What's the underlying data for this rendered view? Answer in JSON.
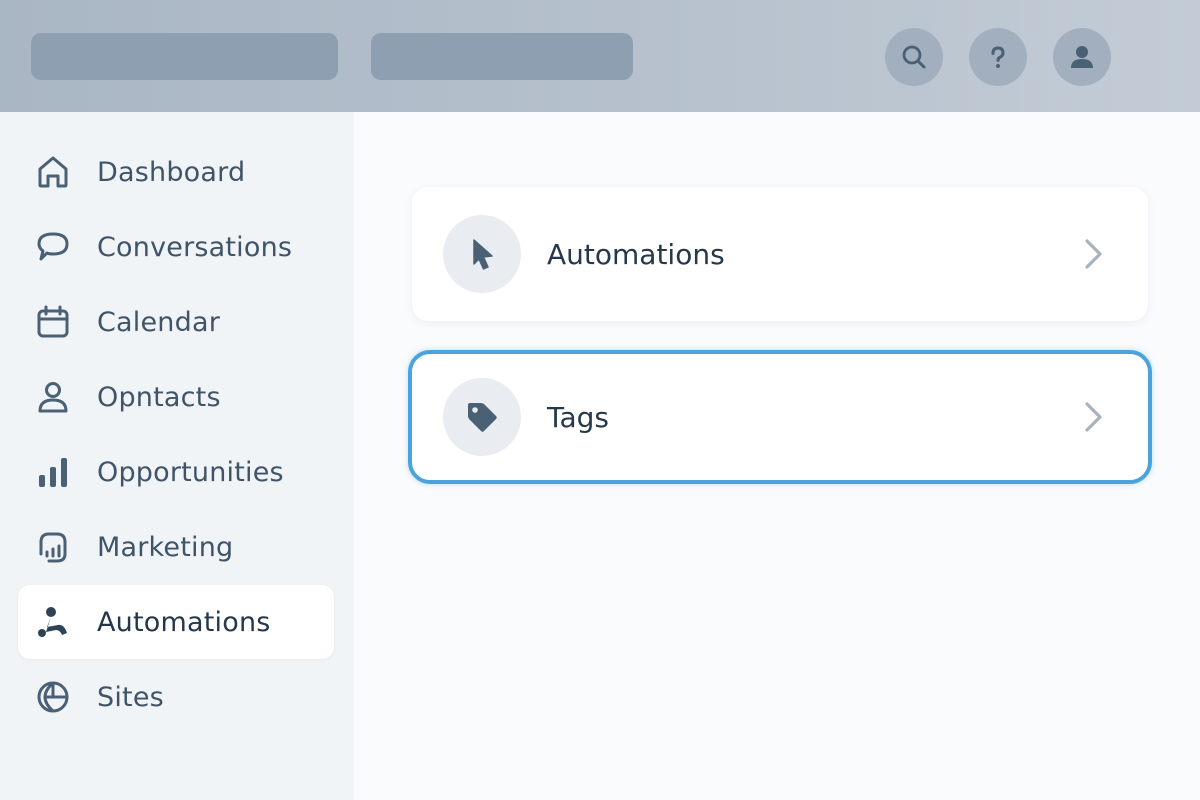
{
  "header": {
    "icons": [
      "search-icon",
      "help-icon",
      "user-icon"
    ]
  },
  "sidebar": {
    "items": [
      {
        "label": "Dashboard",
        "icon": "home-icon"
      },
      {
        "label": "Conversations",
        "icon": "chat-icon"
      },
      {
        "label": "Calendar",
        "icon": "calendar-icon"
      },
      {
        "label": "Opntacts",
        "icon": "contact-icon"
      },
      {
        "label": "Opportunities",
        "icon": "bar-chart-icon"
      },
      {
        "label": "Marketing",
        "icon": "marketing-icon"
      },
      {
        "label": "Automations",
        "icon": "automation-icon",
        "active": true
      },
      {
        "label": "Sites",
        "icon": "globe-icon"
      }
    ]
  },
  "main": {
    "cards": [
      {
        "label": "Automations",
        "icon": "cursor-icon"
      },
      {
        "label": "Tags",
        "icon": "tag-icon",
        "selected": true
      }
    ]
  },
  "colors": {
    "accent": "#4aa3dd",
    "icon": "#4a6075",
    "topbar": "#b6c1cd",
    "sidebar": "#f1f4f7"
  }
}
